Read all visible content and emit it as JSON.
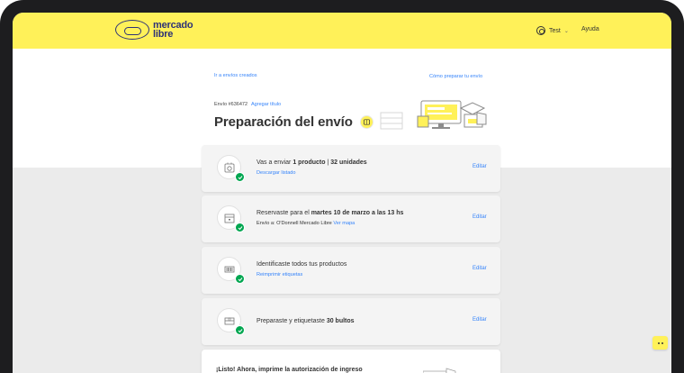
{
  "header": {
    "logo_line1": "mercado",
    "logo_line2": "libre",
    "user_label": "Test",
    "user_caret": "⌄",
    "help_label": "Ayuda",
    "accent_color": "#fff159"
  },
  "hero": {
    "back_link": "Ir a envíos creados",
    "guide_link": "Cómo preparar tu envío",
    "shipment_number": "Envío #636472",
    "add_title": "Agregar título",
    "page_title": "Preparación del envío"
  },
  "steps": [
    {
      "text_prefix": "Vas a enviar ",
      "text_bold1": "1 producto",
      "text_mid": " | ",
      "text_bold2": "32 unidades",
      "sub": "Descargar listado",
      "edit": "Editar",
      "icon": "product-icon"
    },
    {
      "text_prefix": "Reservaste para el ",
      "text_bold1": "martes 10 de marzo a las 13 hs",
      "sub_prefix": "Envío a: O'Donnell Mercado Libre ",
      "sub_link": "Ver mapa",
      "edit": "Editar",
      "icon": "calendar-icon"
    },
    {
      "text_prefix": "Identificaste todos tus productos",
      "sub": "Reimprimir etiquetas",
      "edit": "Editar",
      "icon": "barcode-icon"
    },
    {
      "text_prefix": "Preparaste y etiquetaste ",
      "text_bold1": "30 bultos",
      "edit": "Editar",
      "icon": "box-icon"
    }
  ],
  "final": {
    "text": "¡Listo! Ahora, imprime la autorización de ingreso"
  },
  "colors": {
    "link": "#3483fa",
    "success": "#00a650",
    "brand_blue": "#2d3277"
  }
}
